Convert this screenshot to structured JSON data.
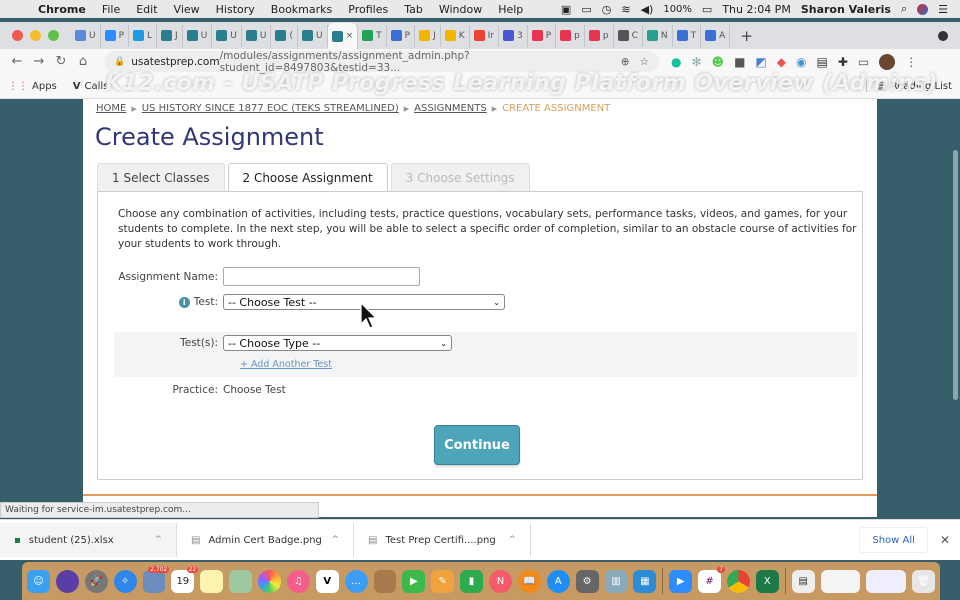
{
  "menubar": {
    "app": "Chrome",
    "items": [
      "File",
      "Edit",
      "View",
      "History",
      "Bookmarks",
      "Profiles",
      "Tab",
      "Window",
      "Help"
    ],
    "battery": "100%",
    "clock": "Thu 2:04 PM",
    "user": "Sharon Valeris"
  },
  "tabs": [
    {
      "label": "U",
      "color": "#5a8bd6"
    },
    {
      "label": "P",
      "color": "#2d8cff"
    },
    {
      "label": "L",
      "color": "#1e9be0"
    },
    {
      "label": "J",
      "color": "#2a7f8f"
    },
    {
      "label": "U",
      "color": "#2a7f8f"
    },
    {
      "label": "U",
      "color": "#2a7f8f"
    },
    {
      "label": "U",
      "color": "#2a7f8f"
    },
    {
      "label": "(",
      "color": "#2a7f8f"
    },
    {
      "label": "U",
      "color": "#2a7f8f"
    },
    {
      "label": "×",
      "color": "#2a7f8f",
      "active": true
    },
    {
      "label": "T",
      "color": "#23a455"
    },
    {
      "label": "P",
      "color": "#3b6fd6"
    },
    {
      "label": "J",
      "color": "#f4b400"
    },
    {
      "label": "K",
      "color": "#f4b400"
    },
    {
      "label": "Ir",
      "color": "#ea4335"
    },
    {
      "label": "3",
      "color": "#4757d6"
    },
    {
      "label": "P",
      "color": "#e8344e"
    },
    {
      "label": "p",
      "color": "#e8344e"
    },
    {
      "label": "p",
      "color": "#e8344e"
    },
    {
      "label": "C",
      "color": "#555555"
    },
    {
      "label": "N",
      "color": "#2a9f8f"
    },
    {
      "label": "T",
      "color": "#3b6fd6"
    },
    {
      "label": "A",
      "color": "#3b6fd6"
    }
  ],
  "address": {
    "host": "usatestprep.com",
    "path": "/modules/assignments/assignment_admin.php?student_id=8497803&testid=33..."
  },
  "bookmarks": {
    "apps": "Apps",
    "calls": "Calls",
    "reading_list": "Reading List"
  },
  "watermark": "K12.com - USATP Progress Learning Platform Overview (Admins)",
  "breadcrumb": {
    "items": [
      "HOME",
      "US HISTORY SINCE 1877 EOC (TEKS STREAMLINED)",
      "ASSIGNMENTS"
    ],
    "current": "CREATE ASSIGNMENT"
  },
  "page_title": "Create Assignment",
  "steps": [
    {
      "label": "1 Select Classes",
      "state": "done"
    },
    {
      "label": "2 Choose Assignment",
      "state": "active"
    },
    {
      "label": "3 Choose Settings",
      "state": "disabled"
    }
  ],
  "intro": "Choose any combination of activities, including tests, practice questions, vocabulary sets, performance tasks, videos, and games, for your students to complete. In the next step, you will be able to select a specific order of completion, similar to an obstacle course of activities for your students to work through.",
  "form": {
    "assignment_name_label": "Assignment Name:",
    "assignment_name_value": "",
    "test_label": "Test:",
    "test_selected": "-- Choose Test --",
    "tests_label": "Test(s):",
    "tests_selected": "-- Choose Type --",
    "add_another_test": "+ Add Another Test",
    "practice_label": "Practice:",
    "practice_value": "Choose Test",
    "continue": "Continue"
  },
  "status_text": "Waiting for service-im.usatestprep.com...",
  "downloads": {
    "items": [
      "student (25).xlsx",
      "Admin Cert Badge.png",
      "Test Prep Certifi....png"
    ],
    "show_all": "Show All"
  },
  "dock": {
    "mail_badge": "2,702",
    "calendar_day": "19",
    "calendar_badge": "22",
    "slack_badge": "7"
  }
}
